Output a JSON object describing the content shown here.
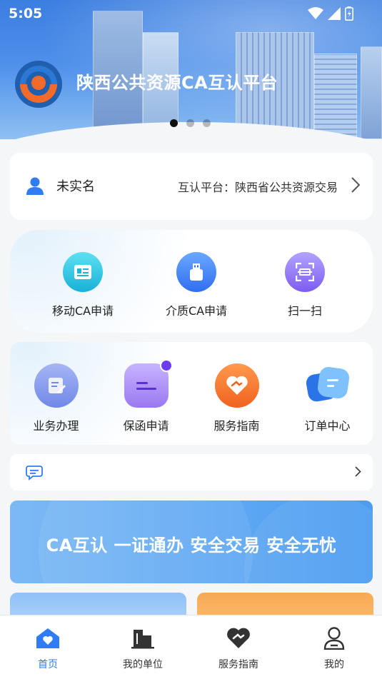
{
  "status_bar": {
    "time": "5:05"
  },
  "header": {
    "app_title": "陕西公共资源CA互认平台",
    "carousel_total": 3,
    "carousel_active": 1
  },
  "user_card": {
    "name": "未实名",
    "platform_text": "互认平台：陕西省公共资源交易"
  },
  "ca_actions": [
    {
      "label": "移动CA申请",
      "icon": "mobile-card-icon",
      "color": "#1fb5d9"
    },
    {
      "label": "介质CA申请",
      "icon": "usb-key-icon",
      "color": "#2f7cf6"
    },
    {
      "label": "扫一扫",
      "icon": "scan-icon",
      "color": "#8a6cf3"
    }
  ],
  "services": [
    {
      "label": "业务办理",
      "icon": "edit-document-icon",
      "color": "#7f95ea"
    },
    {
      "label": "保函申请",
      "icon": "guarantee-icon",
      "color": "#a98af2"
    },
    {
      "label": "服务指南",
      "icon": "heart-handshake-icon",
      "color": "#f26b2b"
    },
    {
      "label": "订单中心",
      "icon": "order-chat-icon",
      "color": "#2f8af6"
    }
  ],
  "notice": {
    "text": ""
  },
  "slogan": {
    "text": "CA互认 一证通办 安全交易 安全无忧"
  },
  "tabbar": {
    "active": 0,
    "items": [
      {
        "label": "首页",
        "icon": "home-heart-icon"
      },
      {
        "label": "我的单位",
        "icon": "building-icon"
      },
      {
        "label": "服务指南",
        "icon": "handshake-heart-icon"
      },
      {
        "label": "我的",
        "icon": "person-icon"
      }
    ]
  },
  "colors": {
    "accent": "#2f7cf6",
    "header_blue": "#3b7ee0",
    "slogan_blue": "#4b9cf2",
    "orange": "#f26b2b"
  }
}
